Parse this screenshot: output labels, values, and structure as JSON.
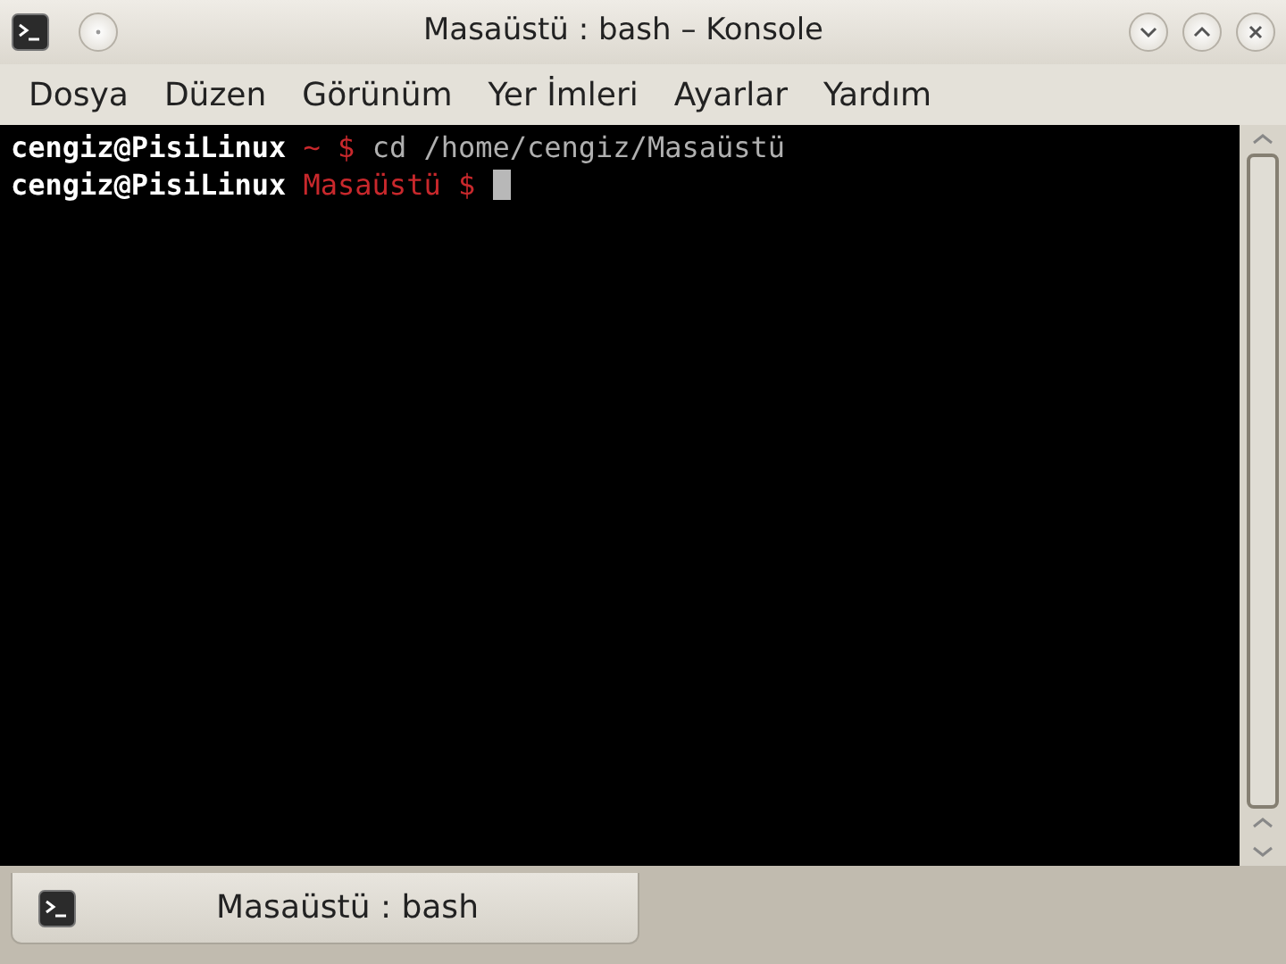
{
  "window": {
    "title": "Masaüstü : bash – Konsole"
  },
  "menu": [
    "Dosya",
    "Düzen",
    "Görünüm",
    "Yer İmleri",
    "Ayarlar",
    "Yardım"
  ],
  "terminal": {
    "lines": [
      {
        "segments": [
          {
            "kind": "user",
            "text": "cengiz@PisiLinux"
          },
          {
            "kind": "prompt",
            "text": "~ $"
          },
          {
            "kind": "command",
            "text": "cd /home/cengiz/Masaüstü"
          }
        ],
        "cursor": false
      },
      {
        "segments": [
          {
            "kind": "user",
            "text": "cengiz@PisiLinux"
          },
          {
            "kind": "prompt",
            "text": "Masaüstü $"
          }
        ],
        "cursor": true
      }
    ]
  },
  "tabs": [
    {
      "label": "Masaüstü : bash",
      "selected": true
    }
  ]
}
